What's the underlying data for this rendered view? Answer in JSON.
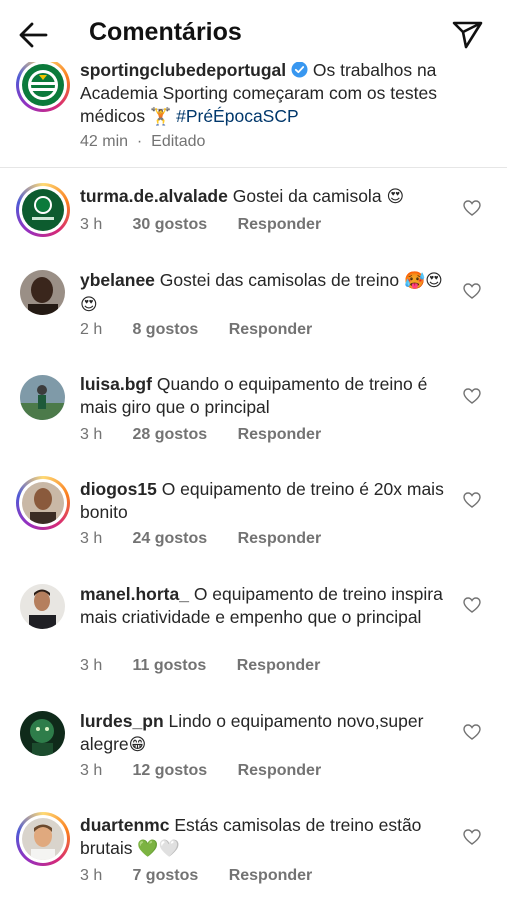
{
  "header": {
    "title": "Comentários",
    "back_icon": "arrow-left-icon",
    "share_icon": "paper-plane-icon"
  },
  "caption": {
    "username": "sportingclubedeportugal",
    "text": "Os trabalhos na Academia Sporting começaram com os testes médicos",
    "emoji": "🏋",
    "hashtag": "#PréÉpocaSCP",
    "time": "42 min",
    "edited": "Editado"
  },
  "comments": [
    {
      "username": "turma.de.alvalade",
      "text": "Gostei da camisola",
      "emoji": "😍",
      "time": "3 h",
      "likes": "30 gostos",
      "reply": "Responder"
    },
    {
      "username": "ybelanee",
      "text": "Gostei das camisolas de treino",
      "emoji": "🥵😍😍",
      "time": "2 h",
      "likes": "8 gostos",
      "reply": "Responder"
    },
    {
      "username": "luisa.bgf",
      "text": "Quando o equipamento de treino é mais giro que o principal",
      "emoji": "",
      "time": "3 h",
      "likes": "28 gostos",
      "reply": "Responder"
    },
    {
      "username": "diogos15",
      "text": "O equipamento de treino é 20x mais bonito",
      "emoji": "",
      "time": "3 h",
      "likes": "24 gostos",
      "reply": "Responder"
    },
    {
      "username": "manel.horta_",
      "text": "O equipamento de treino inspira mais criatividade e empenho que o principal",
      "emoji": "",
      "time": "3 h",
      "likes": "11 gostos",
      "reply": "Responder"
    },
    {
      "username": "lurdes_pn",
      "text": "Lindo o equipamento novo,super alegre",
      "emoji": "😁",
      "time": "3 h",
      "likes": "12 gostos",
      "reply": "Responder"
    },
    {
      "username": "duartenmc",
      "text": "Estás camisolas de treino estão brutais",
      "emoji": "💚🤍",
      "time": "3 h",
      "likes": "7 gostos",
      "reply": "Responder"
    }
  ],
  "colors": {
    "accent_link": "#00376b",
    "meta_gray": "#737373",
    "verified_blue": "#3897f0",
    "sporting_green": "#0b7a3b"
  }
}
